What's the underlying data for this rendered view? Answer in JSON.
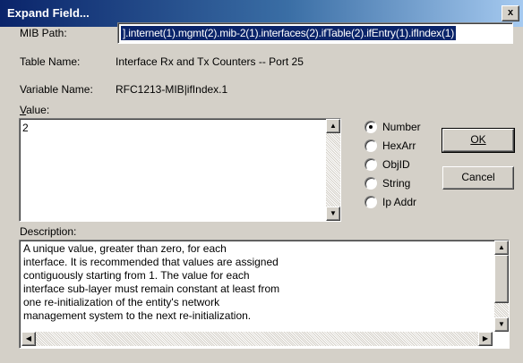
{
  "window": {
    "title": "Expand Field...",
    "close_glyph": "x"
  },
  "mib_path": {
    "label": "MIB Path:",
    "value": "].internet(1).mgmt(2).mib-2(1).interfaces(2).ifTable(2).ifEntry(1).ifIndex(1)"
  },
  "table_name": {
    "label": "Table Name:",
    "value": "Interface Rx and Tx Counters -- Port 25"
  },
  "variable_name": {
    "label": "Variable Name:",
    "value": "RFC1213-MIB|ifIndex.1"
  },
  "value_field": {
    "label": "Value:",
    "value": "2"
  },
  "type_options": [
    {
      "label": "Number",
      "selected": true
    },
    {
      "label": "HexArr",
      "selected": false
    },
    {
      "label": "ObjID",
      "selected": false
    },
    {
      "label": "String",
      "selected": false
    },
    {
      "label": "Ip Addr",
      "selected": false
    }
  ],
  "buttons": {
    "ok": "OK",
    "cancel": "Cancel"
  },
  "description": {
    "label": "Description:",
    "text": "A unique value, greater than zero, for each\ninterface.  It is recommended that values are assigned\ncontiguously starting from 1.  The value for each\ninterface sub-layer must remain constant at least from\none re-initialization of the entity's network\nmanagement system to the next re-initialization."
  },
  "scroll_glyphs": {
    "up": "▲",
    "down": "▼",
    "left": "◀",
    "right": "▶"
  }
}
